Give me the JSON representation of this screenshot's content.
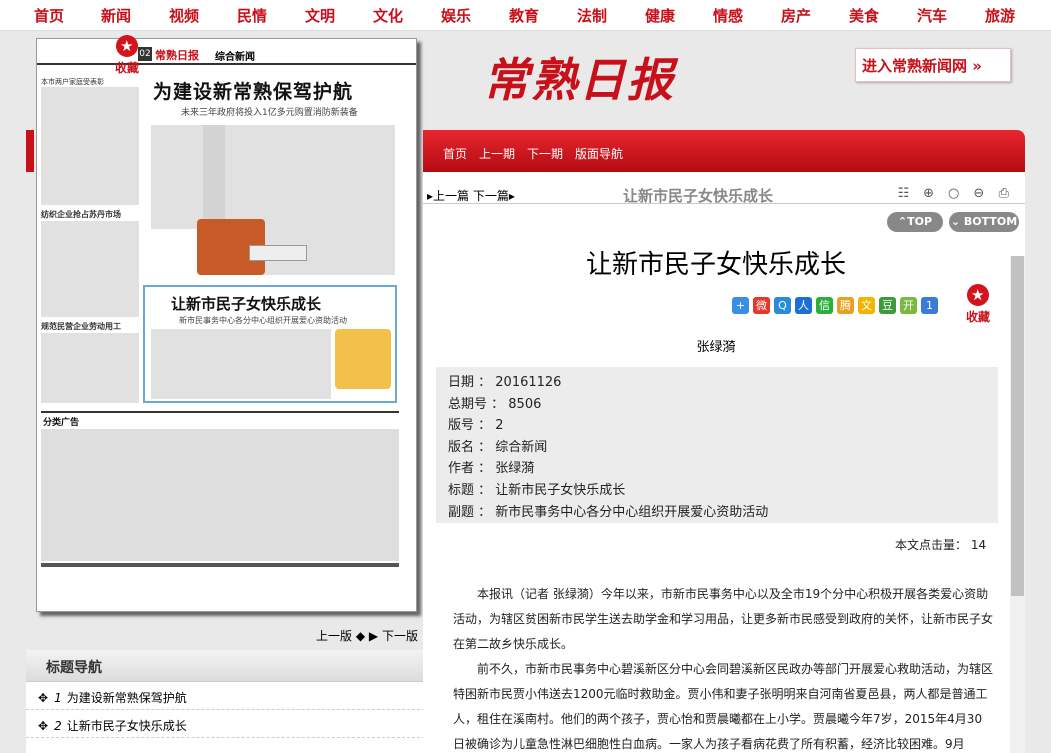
{
  "topnav": [
    "首页",
    "新闻",
    "视频",
    "民情",
    "文明",
    "文化",
    "娱乐",
    "教育",
    "法制",
    "健康",
    "情感",
    "房产",
    "美食",
    "汽车",
    "旅游"
  ],
  "fav_label": "收藏",
  "paper": {
    "masthead": "常熟日报",
    "page_no": "02",
    "page_name": "综合新闻",
    "headline": "为建设新常熟保驾护航",
    "subhead": "未来三年政府将投入1亿多元购置消防新装备",
    "feature_title": "让新市民子女快乐成长",
    "feature_sub": "新市民事务中心各分中心组织开展爱心资助活动",
    "left_col_1": "本市两户家庭受表彰",
    "left_col_2": "纺织企业抢占苏丹市场",
    "left_col_3": "规范民营企业劳动用工",
    "ads_title": "分类广告"
  },
  "pagenav": {
    "prev": "上一版",
    "next": "下一版"
  },
  "headline_nav": {
    "title": "标题导航",
    "items": [
      {
        "num": "1",
        "label": "为建设新常熟保驾护航"
      },
      {
        "num": "2",
        "label": "让新市民子女快乐成长"
      }
    ]
  },
  "logo": "常熟日报",
  "enter_site": "进入常熟新闻网",
  "subnav": [
    "首页",
    "上一期",
    "下一期",
    "版面导航"
  ],
  "toolbar": {
    "prev": "上一篇",
    "next": "下一篇",
    "title": "让新市民子女快乐成长"
  },
  "scroll_buttons": {
    "top": "TOP",
    "bottom": "BOTTOM"
  },
  "article": {
    "title": "让新市民子女快乐成长",
    "author": "张绿漪",
    "meta": [
      {
        "k": "日期",
        "v": "20161126"
      },
      {
        "k": "总期号",
        "v": "8506"
      },
      {
        "k": "版号",
        "v": "2"
      },
      {
        "k": "版名",
        "v": "综合新闻"
      },
      {
        "k": "作者",
        "v": "张绿漪"
      },
      {
        "k": "标题",
        "v": "让新市民子女快乐成长"
      },
      {
        "k": "副题",
        "v": "新市民事务中心各分中心组织开展爱心资助活动"
      }
    ],
    "hits_label": "本文点击量：",
    "hits": "14",
    "paragraphs": [
      "本报讯（记者 张绿漪）今年以来，市新市民事务中心以及全市19个分中心积极开展各类爱心资助活动，为辖区贫困新市民学生送去助学金和学习用品，让更多新市民感受到政府的关怀，让新市民子女在第二故乡快乐成长。",
      "前不久，市新市民事务中心碧溪新区分中心会同碧溪新区民政办等部门开展爱心救助活动，为辖区特困新市民贾小伟送去1200元临时救助金。贾小伟和妻子张明明来自河南省夏邑县，两人都是普通工人，租住在溪南村。他们的两个孩子，贾心怡和贾晨曦都在上小学。贾晨曦今年7岁，2015年4月30日被确诊为儿童急性淋巴细胞性白血病。一家人为孩子看病花费了所有积蓄，经济比较困难。9月"
    ]
  }
}
